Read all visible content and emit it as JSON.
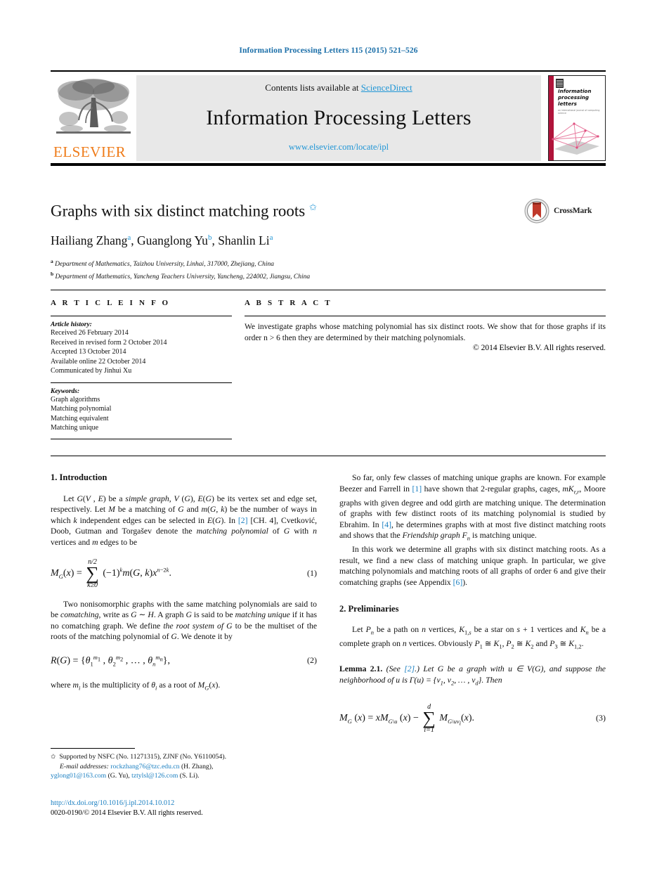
{
  "running_head": "Information Processing Letters 115 (2015) 521–526",
  "masthead": {
    "contents_prefix": "Contents lists available at ",
    "contents_link": "ScienceDirect",
    "journal_title": "Information Processing Letters",
    "journal_url": "www.elsevier.com/locate/ipl",
    "publisher": "ELSEVIER",
    "cover_title_line1": "information",
    "cover_title_line2": "processing",
    "cover_title_line3": "letters",
    "cover_subtitle": "an international journal of computing science"
  },
  "article": {
    "title": "Graphs with six distinct matching roots",
    "title_marker": "✩",
    "authors": [
      {
        "name": "Hailiang Zhang",
        "sup": "a"
      },
      {
        "name": "Guanglong Yu",
        "sup": "b"
      },
      {
        "name": "Shanlin Li",
        "sup": "a"
      }
    ],
    "authors_line": "Hailiang Zhang a, Guanglong Yu b, Shanlin Li a",
    "affiliations": [
      {
        "sup": "a",
        "text": "Department of Mathematics, Taizhou University, Linhai, 317000, Zhejiang, China"
      },
      {
        "sup": "b",
        "text": "Department of Mathematics, Yancheng Teachers University, Yancheng, 224002, Jiangsu, China"
      }
    ],
    "crossmark_label": "CrossMark"
  },
  "info": {
    "heading": "A R T I C L E   I N F O",
    "history_label": "Article history:",
    "history": [
      "Received 26 February 2014",
      "Received in revised form 2 October 2014",
      "Accepted 13 October 2014",
      "Available online 22 October 2014",
      "Communicated by Jinhui Xu"
    ],
    "keywords_label": "Keywords:",
    "keywords": [
      "Graph algorithms",
      "Matching polynomial",
      "Matching equivalent",
      "Matching unique"
    ]
  },
  "abstract": {
    "heading": "A B S T R A C T",
    "text": "We investigate graphs whose matching polynomial has six distinct roots. We show that for those graphs if its order n > 6 then they are determined by their matching polynomials.",
    "copyright": "© 2014 Elsevier B.V. All rights reserved."
  },
  "body": {
    "left": {
      "section1_heading": "1. Introduction",
      "p1_a": "Let ",
      "p1_text": "Let G(V , E) be a simple graph, V (G), E(G) be its vertex set and edge set, respectively. Let M be a matching of G and m(G, k) be the number of ways in which k independent edges can be selected in E(G). In [2] [CH. 4], Cvetković, Doob, Gutman and Torgašev denote the matching polynomial of G with n vertices and m edges to be",
      "eq1_number": "(1)",
      "eq1_lhs": "M",
      "eq1_text": "M_G(x) = Σ(−1)^k m(G, k) x^{n−2k}.",
      "eq1_sum_top": "n/2",
      "eq1_sum_bot": "k≥0",
      "p2_text": "Two nonisomorphic graphs with the same matching polynomials are said to be comatching, write as G ∼ H. A graph G is said to be matching unique if it has no comatching graph. We define the root system of G to be the multiset of the roots of the matching polynomial of G. We denote it by",
      "eq2_number": "(2)",
      "eq2_text": "R(G) = {θ₁^{m₁}, θ₂^{m₂}, ..., θₙ^{mₙ}},",
      "p3_text": "where mᵢ is the multiplicity of θᵢ as a root of M_G(x)."
    },
    "right": {
      "p1_text": "So far, only few classes of matching unique graphs are known. For example Beezer and Farrell in [1] have shown that 2-regular graphs, cages, mK_{r,r}, Moore graphs with given degree and odd girth are matching unique. The determination of graphs with few distinct roots of its matching polynomial is studied by Ebrahim. In [4], he determines graphs with at most five distinct matching roots and shows that the Friendship graph F_n is matching unique.",
      "p2_text": "In this work we determine all graphs with six distinct matching roots. As a result, we find a new class of matching unique graph. In particular, we give matching polynomials and matching roots of all graphs of order 6 and give their comatching graphs (see Appendix [6]).",
      "section2_heading": "2. Preliminaries",
      "p3_text": "Let P_n be a path on n vertices, K_{1,s} be a star on s + 1 vertices and K_n be a complete graph on n vertices. Obviously P₁ ≅ K₁, P₂ ≅ K₂ and P₃ ≅ K_{1,2}.",
      "lemma_label": "Lemma 2.1.",
      "lemma_see": "(See [2].)",
      "lemma_text": "Let G be a graph with u ∈ V(G), and suppose the neighborhood of u is Γ(u) = {v₁, v₂, ..., v_d}. Then",
      "eq3_number": "(3)",
      "eq3_text": "M_G(x) = xM_{G\\u}(x) − Σ M_{G\\uvᵢ}(x).",
      "eq3_sum_top": "d",
      "eq3_sum_bot": "i=1"
    }
  },
  "footnote": {
    "star": "✩",
    "support": "Supported by NSFC (No. 11271315), ZJNF (No. Y6110054).",
    "email_label": "E-mail addresses:",
    "emails": [
      {
        "address": "rockzhang76@tzc.edu.cn",
        "person": "(H. Zhang)"
      },
      {
        "address": "yglong01@163.com",
        "person": "(G. Yu)"
      },
      {
        "address": "tztylsl@126.com",
        "person": "(S. Li)"
      }
    ],
    "doi": "http://dx.doi.org/10.1016/j.ipl.2014.10.012",
    "issn_copyright": "0020-0190/© 2014 Elsevier B.V. All rights reserved."
  },
  "citations": {
    "c1": "[1]",
    "c2": "[2]",
    "c4": "[4]",
    "c6": "[6]"
  },
  "colors": {
    "link": "#1a7fc1",
    "header_blue": "#1a6ea8",
    "sciencedirect_blue": "#2196d6",
    "elsevier_orange": "#ef7c1a",
    "cover_red": "#b0133a"
  }
}
